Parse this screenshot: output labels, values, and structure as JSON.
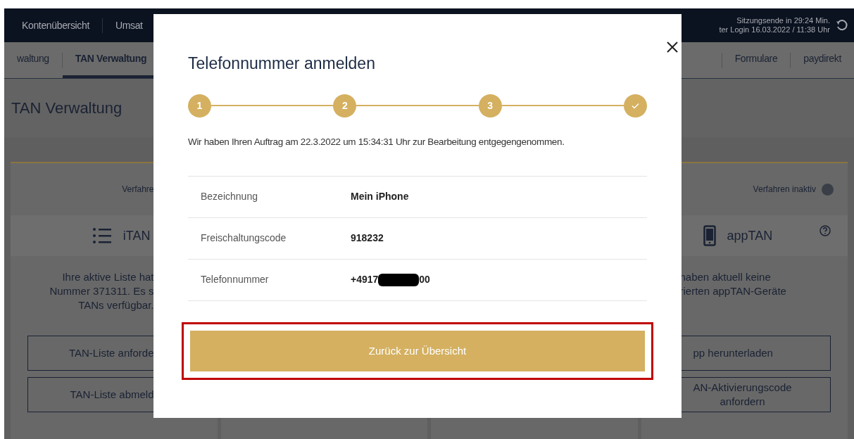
{
  "nav": {
    "left": [
      "Kontenübersicht",
      "Umsat"
    ],
    "session": [
      "Sitzungsende in 29:24 Min.",
      "ter Login 16.03.2022 / 11:38 Uhr"
    ]
  },
  "tabs_left": [
    {
      "label": "waltung",
      "selected": false
    },
    {
      "label": "TAN Verwaltung",
      "selected": true
    }
  ],
  "tabs_right": [
    {
      "label": "Formulare",
      "selected": false
    },
    {
      "label": "paydirekt",
      "selected": false
    }
  ],
  "page_title": "TAN Verwaltung",
  "cards": [
    {
      "status": "Verfahre",
      "title": "iTAN",
      "text": [
        "Ihre aktive Liste hat",
        "Nummer 371311. Es s",
        "TANs verfügbar."
      ],
      "buttons": [
        [
          "TAN-Liste anforde"
        ],
        [
          "TAN-Liste abmeld"
        ]
      ]
    },
    {
      "status": "Verfahren inaktiv",
      "status_active": false,
      "title": "appTAN",
      "text": [
        "haben aktuell keine",
        "rierten appTAN-Geräte"
      ],
      "buttons": [
        [
          "pp herunterladen"
        ],
        [
          "AN-Aktivierungscode",
          "anfordern"
        ]
      ],
      "help": true
    }
  ],
  "modal": {
    "title": "Telefonnummer anmelden",
    "steps": [
      {
        "kind": "number",
        "label": "1",
        "done": true
      },
      {
        "kind": "number",
        "label": "2",
        "done": true
      },
      {
        "kind": "number",
        "label": "3",
        "done": true
      },
      {
        "kind": "check",
        "done": true
      }
    ],
    "message": "Wir haben Ihren Auftrag am 22.3.2022 um 15:34:31 Uhr zur Bearbeitung entgegengenommen.",
    "rows": [
      {
        "label": "Bezeichnung",
        "value": [
          "Mein iPhone"
        ]
      },
      {
        "label": "Freischaltungscode",
        "value": [
          "918232"
        ]
      },
      {
        "label": "Telefonnummer",
        "value": [
          "+4917",
          "00"
        ],
        "redacted": true
      }
    ],
    "button": "Zurück zur Übersicht",
    "highlighted": true
  }
}
